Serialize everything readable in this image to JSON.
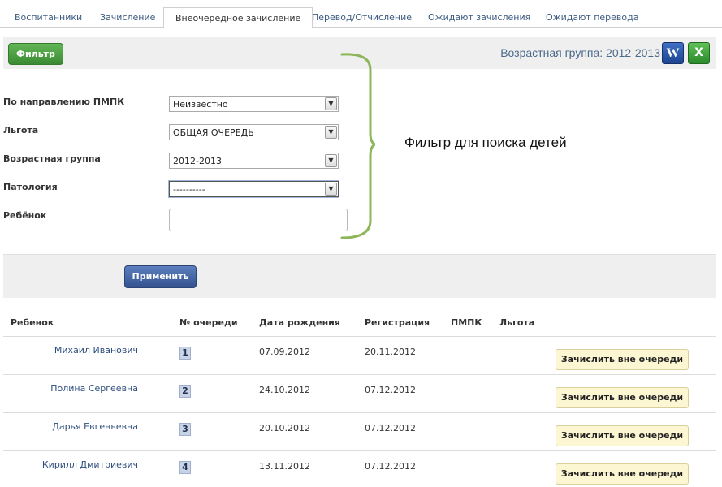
{
  "tabs": [
    {
      "label": "Воспитанники"
    },
    {
      "label": "Зачисление"
    },
    {
      "label": "Внеочередное зачисление",
      "active": true
    },
    {
      "label": "Перевод/Отчисление"
    },
    {
      "label": "Ожидают зачисления"
    },
    {
      "label": "Ожидают перевода"
    }
  ],
  "toolbar": {
    "filter_label": "Фильтр",
    "age_group_title": "Возрастная группа: 2012-2013",
    "word_icon": "word-export-icon",
    "word_glyph": "W",
    "excel_icon": "excel-export-icon",
    "excel_glyph": "X"
  },
  "filters": [
    {
      "label": "По направлению ПМПК",
      "value": "Неизвестно"
    },
    {
      "label": "Льгота",
      "value": "ОБЩАЯ ОЧЕРЕДЬ"
    },
    {
      "label": "Возрастная группа",
      "value": "2012-2013"
    },
    {
      "label": "Патология",
      "value": "----------"
    }
  ],
  "child_field": {
    "label": "Ребёнок",
    "value": ""
  },
  "annotation": "Фильтр для поиска детей",
  "apply_label": "Применить",
  "table": {
    "headers": [
      "Ребенок",
      "№ очереди",
      "Дата рождения",
      "Регистрация",
      "ПМПК",
      "Льгота"
    ],
    "rows": [
      {
        "name": "Михаил Иванович",
        "queue": "1",
        "birth": "07.09.2012",
        "reg": "20.11.2012",
        "action": "Зачислить вне очереди"
      },
      {
        "name": "Полина Сергеевна",
        "queue": "2",
        "birth": "24.10.2012",
        "reg": "07.12.2012",
        "action": "Зачислить вне очереди"
      },
      {
        "name": "Дарья Евгеньевна",
        "queue": "3",
        "birth": "20.10.2012",
        "reg": "07.12.2012",
        "action": "Зачислить вне очереди"
      },
      {
        "name": "Кирилл Дмитриевич",
        "queue": "4",
        "birth": "13.11.2012",
        "reg": "07.12.2012",
        "action": "Зачислить вне очереди"
      }
    ]
  },
  "colors": {
    "filter_button": "#4a9e40",
    "apply_button": "#4266a4",
    "enroll_button": "#fdf6d3",
    "annotation_bracket": "#8db55a"
  }
}
